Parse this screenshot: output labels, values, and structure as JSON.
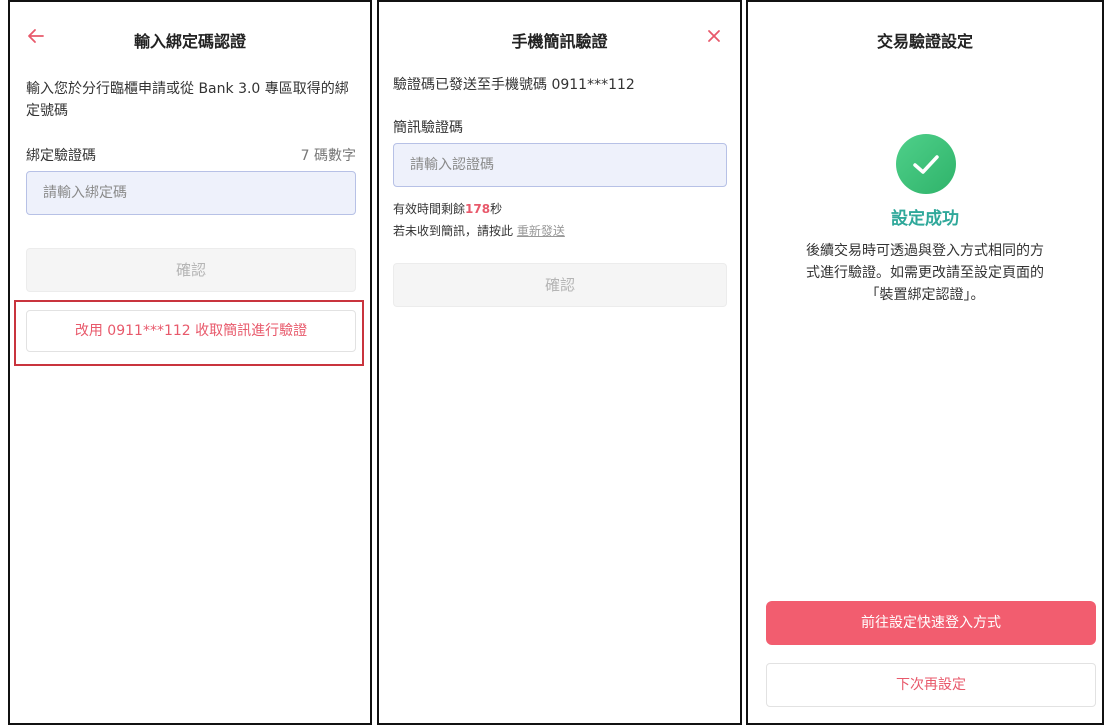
{
  "panel1": {
    "title": "輸入綁定碼認證",
    "description": "輸入您於分行臨櫃申請或從 Bank 3.0 專區取得的綁定號碼",
    "field_label": "綁定驗證碼",
    "field_hint": "7 碼數字",
    "field_value": "",
    "field_placeholder": "請輸入綁定碼",
    "confirm_label": "確認",
    "alt_sms_label": "改用 0911***112 收取簡訊進行驗證"
  },
  "panel2": {
    "title": "手機簡訊驗證",
    "sent_message": "驗證碼已發送至手機號碼 0911***112",
    "field_label": "簡訊驗證碼",
    "field_value": "",
    "field_placeholder": "請輸入認證碼",
    "valid_prefix": "有效時間剩餘",
    "countdown_seconds": "178",
    "valid_suffix": "秒",
    "not_received": "若未收到簡訊，請按此",
    "resend_label": "重新發送",
    "confirm_label": "確認"
  },
  "panel3": {
    "title": "交易驗證設定",
    "success_title": "設定成功",
    "success_line1": "後續交易時可透過與登入方式相同的方",
    "success_line2": "式進行驗證。如需更改請至設定頁面的",
    "success_line3": "「裝置綁定認證」。",
    "primary_label": "前往設定快速登入方式",
    "secondary_label": "下次再設定"
  },
  "icons": {
    "back": "arrow-left-icon",
    "close": "close-icon",
    "success": "check-circle-icon"
  },
  "colors": {
    "accent": "#e8596b",
    "primary_button": "#f25d6f",
    "success_green": "#3cc46f",
    "success_text": "#2fa89a",
    "highlight_border": "#c9343d",
    "input_bg": "#eef1fb",
    "input_border": "#b7c1e6"
  }
}
